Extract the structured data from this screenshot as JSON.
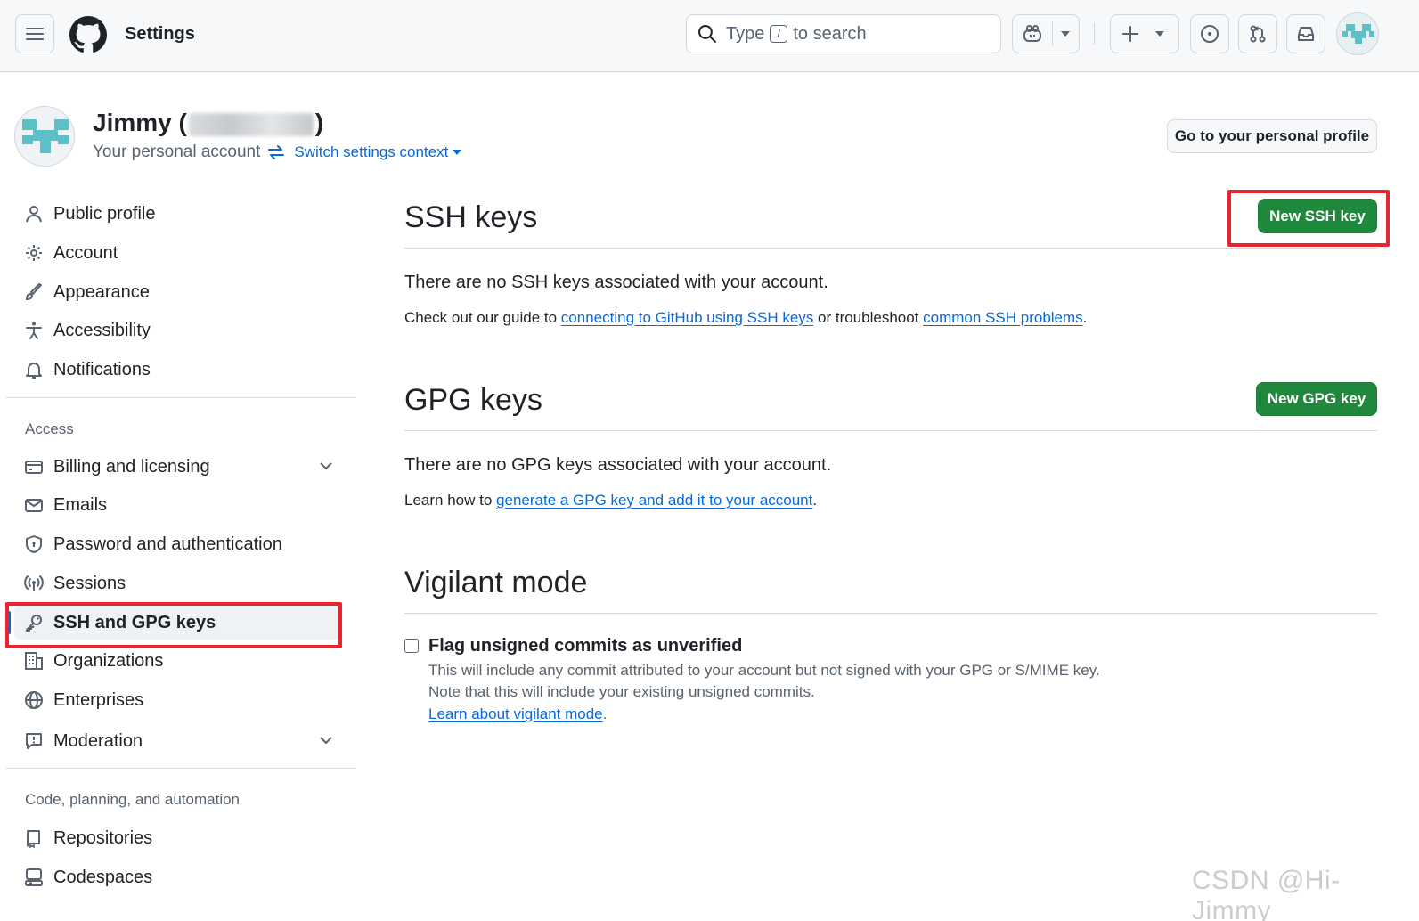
{
  "header": {
    "title": "Settings",
    "search_prefix": "Type",
    "search_key": "/",
    "search_suffix": "to search"
  },
  "profile": {
    "name_open": "Jimmy (",
    "name_close": ")",
    "subtitle": "Your personal account",
    "switch_context": "Switch settings context",
    "goto_profile_button": "Go to your personal profile"
  },
  "sidebar": {
    "items_top": [
      {
        "label": "Public profile",
        "icon": "person-icon"
      },
      {
        "label": "Account",
        "icon": "gear-icon"
      },
      {
        "label": "Appearance",
        "icon": "paintbrush-icon"
      },
      {
        "label": "Accessibility",
        "icon": "accessibility-icon"
      },
      {
        "label": "Notifications",
        "icon": "bell-icon"
      }
    ],
    "access_label": "Access",
    "items_access": [
      {
        "label": "Billing and licensing",
        "icon": "credit-card-icon",
        "expandable": true
      },
      {
        "label": "Emails",
        "icon": "mail-icon"
      },
      {
        "label": "Password and authentication",
        "icon": "shield-icon"
      },
      {
        "label": "Sessions",
        "icon": "broadcast-icon"
      },
      {
        "label": "SSH and GPG keys",
        "icon": "key-icon",
        "active": true
      },
      {
        "label": "Organizations",
        "icon": "organization-icon"
      },
      {
        "label": "Enterprises",
        "icon": "globe-icon"
      },
      {
        "label": "Moderation",
        "icon": "report-icon",
        "expandable": true
      }
    ],
    "code_label": "Code, planning, and automation",
    "items_code": [
      {
        "label": "Repositories",
        "icon": "repo-icon"
      },
      {
        "label": "Codespaces",
        "icon": "codespaces-icon"
      }
    ]
  },
  "ssh": {
    "heading": "SSH keys",
    "new_button": "New SSH key",
    "empty_message": "There are no SSH keys associated with your account.",
    "guide_prefix": "Check out our guide to",
    "guide_link": "connecting to GitHub using SSH keys",
    "guide_middle": "or troubleshoot",
    "guide_link2": "common SSH problems",
    "guide_end": "."
  },
  "gpg": {
    "heading": "GPG keys",
    "new_button": "New GPG key",
    "empty_message": "There are no GPG keys associated with your account.",
    "learn_prefix": "Learn how to",
    "learn_link": "generate a GPG key and add it to your account",
    "learn_end": "."
  },
  "vigilant": {
    "heading": "Vigilant mode",
    "checkbox_label": "Flag unsigned commits as unverified",
    "checked": false,
    "note1": "This will include any commit attributed to your account but not signed with your GPG or S/MIME key.",
    "note2": "Note that this will include your existing unsigned commits.",
    "learn_link": "Learn about vigilant mode",
    "learn_end": "."
  },
  "watermark": "CSDN @Hi-Jimmy",
  "colors": {
    "accent": "#0969da",
    "primary_button": "#1f883d",
    "highlight_box": "#e8242c"
  }
}
